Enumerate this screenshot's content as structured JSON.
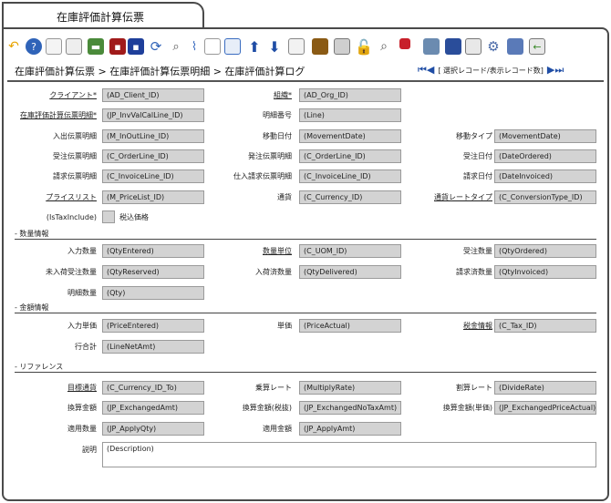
{
  "window": {
    "tab_title": "在庫評価計算伝票"
  },
  "breadcrumb": "在庫評価計算伝票 > 在庫評価計算伝票明細 > 在庫評価計算ログ",
  "navigation": {
    "record_label": "[ 選択レコード/表示レコード数]"
  },
  "header_rows": [
    {
      "label": "クライアント*",
      "value": "(AD_Client_ID)",
      "link": true
    },
    {
      "label": "組織*",
      "value": "(AD_Org_ID)",
      "link": true
    },
    {
      "label": "在庫評価計算伝票明細*",
      "value": "(JP_InvValCalLine_ID)",
      "link": true
    },
    {
      "label": "明細番号",
      "value": "(Line)"
    },
    {
      "label": "入出伝票明細",
      "value": "(M_InOutLine_ID)"
    },
    {
      "label": "移動日付",
      "value": "(MovementDate)"
    },
    {
      "label": "移動タイプ",
      "value": "(MovementDate)"
    },
    {
      "label": "受注伝票明細",
      "value": "(C_OrderLine_ID)"
    },
    {
      "label": "発注伝票明細",
      "value": "(C_OrderLine_ID)"
    },
    {
      "label": "受注日付",
      "value": "(DateOrdered)"
    },
    {
      "label": "請求伝票明細",
      "value": "(C_InvoiceLine_ID)"
    },
    {
      "label": "仕入請求伝票明細",
      "value": "(C_InvoiceLine_ID)"
    },
    {
      "label": "請求日付",
      "value": "(DateInvoiced)"
    },
    {
      "label": "プライスリスト",
      "value": "(M_PriceList_ID)",
      "link": true
    },
    {
      "label": "通貨",
      "value": "(C_Currency_ID)"
    },
    {
      "label": "通貨レートタイプ",
      "value": "(C_ConversionType_ID)",
      "link": true
    },
    {
      "label": "(IsTaxInclude)",
      "checkbox_label": "税込価格"
    }
  ],
  "sections": {
    "quantity": {
      "title": "- 数量情報",
      "rows": [
        {
          "label": "入力数量",
          "value": "(QtyEntered)"
        },
        {
          "label": "数量単位",
          "value": "(C_UOM_ID)",
          "link": true
        },
        {
          "label": "受注数量",
          "value": "(QtyOrdered)"
        },
        {
          "label": "未入荷受注数量",
          "value": "(QtyReserved)"
        },
        {
          "label": "入荷済数量",
          "value": "(QtyDelivered)"
        },
        {
          "label": "請求済数量",
          "value": "(QtyInvoiced)"
        },
        {
          "label": "明細数量",
          "value": "(Qty)"
        }
      ]
    },
    "amount": {
      "title": "- 金額情報",
      "rows": [
        {
          "label": "入力単価",
          "value": "(PriceEntered)"
        },
        {
          "label": "単価",
          "value": "(PriceActual)"
        },
        {
          "label": "税金情報",
          "value": "(C_Tax_ID)",
          "link": true
        },
        {
          "label": "行合計",
          "value": "(LineNetAmt)"
        }
      ]
    },
    "reference": {
      "title": "- リファレンス",
      "rows": [
        {
          "label": "目標通貨",
          "value": "(C_Currency_ID_To)",
          "link": true
        },
        {
          "label": "乗算レート",
          "value": "(MultiplyRate)"
        },
        {
          "label": "割算レート",
          "value": "(DivideRate)"
        },
        {
          "label": "換算金額",
          "value": "(JP_ExchangedAmt)"
        },
        {
          "label": "換算金額(税抜)",
          "value": "(JP_ExchangedNoTaxAmt)"
        },
        {
          "label": "換算金額(単価)",
          "value": "(JP_ExchangedPriceActual)"
        },
        {
          "label": "適用数量",
          "value": "(JP_ApplyQty)"
        },
        {
          "label": "適用金額",
          "value": "(JP_ApplyAmt)"
        }
      ]
    }
  },
  "description": {
    "label": "説明",
    "value": "(Description)"
  },
  "toolbar_icons": [
    "undo-icon",
    "help-icon",
    "new-record-icon",
    "copy-record-icon",
    "delete-icon",
    "save-icon",
    "save-and-new-icon",
    "refresh-icon",
    "find-icon",
    "attachment-icon",
    "chat-icon",
    "grid-toggle-icon",
    "parent-record-icon",
    "detail-record-icon",
    "report-icon",
    "archive-icon",
    "print-icon",
    "lock-icon",
    "zoom-across-icon",
    "workflow-icon",
    "product-info-icon",
    "record-info-icon",
    "window-info-icon",
    "settings-icon",
    "request-icon",
    "exit-icon"
  ],
  "colors": {
    "field_bg": "#d3d3d3",
    "nav_arrow": "#1f4da5",
    "border": "#4a4a4a"
  }
}
